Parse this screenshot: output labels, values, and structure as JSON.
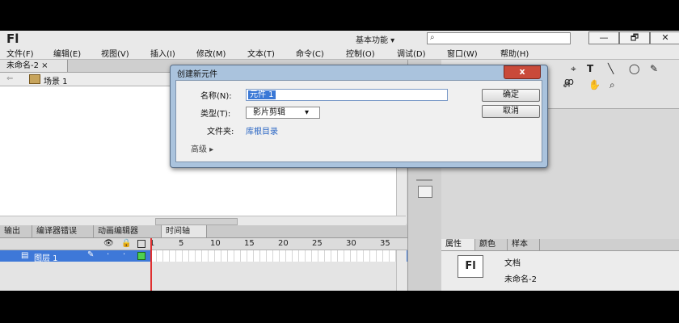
{
  "app": {
    "logo": "Fl",
    "workspace": "基本功能 ▾",
    "window_buttons": [
      "—",
      "🗗",
      "✕"
    ]
  },
  "menu": [
    "文件(F)",
    "编辑(E)",
    "视图(V)",
    "插入(I)",
    "修改(M)",
    "文本(T)",
    "命令(C)",
    "控制(O)",
    "调试(D)",
    "窗口(W)",
    "帮助(H)"
  ],
  "document": {
    "tab_label": "未命名-2 ×",
    "scene_label": "场景 1"
  },
  "bottom_tabs": [
    "输出",
    "编译器错误",
    "动画编辑器",
    "时间轴"
  ],
  "timeline": {
    "frame_numbers": [
      "1",
      "5",
      "10",
      "15",
      "20",
      "25",
      "30",
      "35"
    ],
    "layer_name": "图层 1"
  },
  "properties": {
    "tabs": [
      "属性",
      "颜色",
      "样本"
    ],
    "fl_icon": "Fl",
    "doc_label": "文档",
    "doc_name": "未命名-2"
  },
  "dialog": {
    "title": "创建新元件",
    "close_label": "x",
    "name_label": "名称(N):",
    "name_value": "元件 1",
    "type_label": "类型(T):",
    "type_value": "影片剪辑",
    "folder_label": "文件夹:",
    "folder_value": "库根目录",
    "advanced_label": "高级 ▸",
    "ok_label": "确定",
    "cancel_label": "取消"
  }
}
